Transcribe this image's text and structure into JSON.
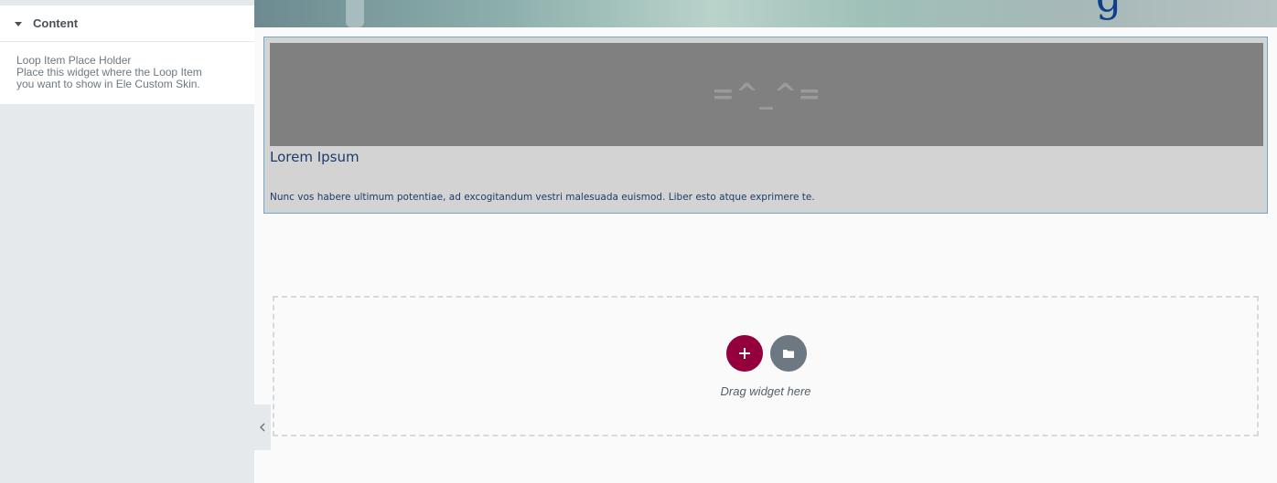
{
  "panel": {
    "section_title": "Content",
    "widget_name": "Loop Item Place Holder",
    "description_line1": "Place this widget where the Loop Item",
    "description_line2": "you want to show in Ele Custom Skin."
  },
  "preview": {
    "loop_item": {
      "placeholder_text": "=^_^=",
      "title": "Lorem Ipsum",
      "excerpt": "Nunc vos habere ultimum potentiae, ad excogitandum vestri malesuada euismod. Liber esto atque exprimere te."
    },
    "hero_glyph": "g",
    "drop_zone": {
      "label": "Drag widget here"
    }
  },
  "colors": {
    "add_button": "#93003c",
    "template_button": "#6d7882",
    "loop_item_border": "#71a7c9",
    "text_dark_blue": "#1b3c6b"
  },
  "icons": {
    "section_toggle": "caret-down-icon",
    "add": "plus-icon",
    "template": "folder-icon",
    "collapse_panel": "chevron-left-icon"
  }
}
